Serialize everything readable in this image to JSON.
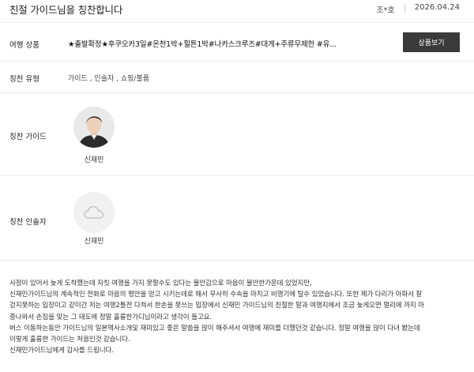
{
  "header": {
    "title": "친절 가이드님을 칭찬합니다",
    "author": "조*호",
    "date": "2026.04.24"
  },
  "product": {
    "label": "여행 상품",
    "value": "★출발확정★후쿠오카3일#온천1박+힐튼1박#나카스크루즈#대게+주류무제한 #유...",
    "button_label": "상품보기"
  },
  "praise_type": {
    "label": "칭찬 유형",
    "value": "가이드 , 인솔자 , 쇼핑/불품"
  },
  "praise_guide": {
    "label": "칭찬 가이드",
    "name": "신재민"
  },
  "praise_escort": {
    "label": "칭찬 인솔자",
    "name": "신재민",
    "icon": "cloud-placeholder-icon"
  },
  "content": {
    "lines": [
      "사정이 있어서 늦게 도착했는데 자칫 여행을 가지 못할수도 있다는 불안감으로 마음이 불안한가운데 있었지만,",
      "신재민가이드님의 계속적인 전화로 마음의 평안을 얻고 시키는데로 해서 무사히 수속을 마치고 비행기에 탈수 있었습니다. 또한 제가 다리가 아파서 잘",
      "걷지못하는 입장이고 같이간 저는 여행2틀전 다쳐서 한손을 못쓰는 입장에서 신재민 가이드님의 친절한 말과 여행지에서 조금 늦게오면 멀리에 까지 마",
      "중나와서 손짐을 맞는 그 태도에 정말 훌륭한가디님이라고 생각이 들고요.",
      "버스 이동하는동안 가이드님의 일본역사소개및 재미있고 좋은 말씀을 많이 해주셔서 여행에 재미를 더했던것 같습니다. 정말 여행을 많이 다녀 봤는데",
      "이렇게 훌륭한 가이드는 처음인것 같습니다.",
      "신재민가이드님에게 감사를 드립니다."
    ]
  }
}
